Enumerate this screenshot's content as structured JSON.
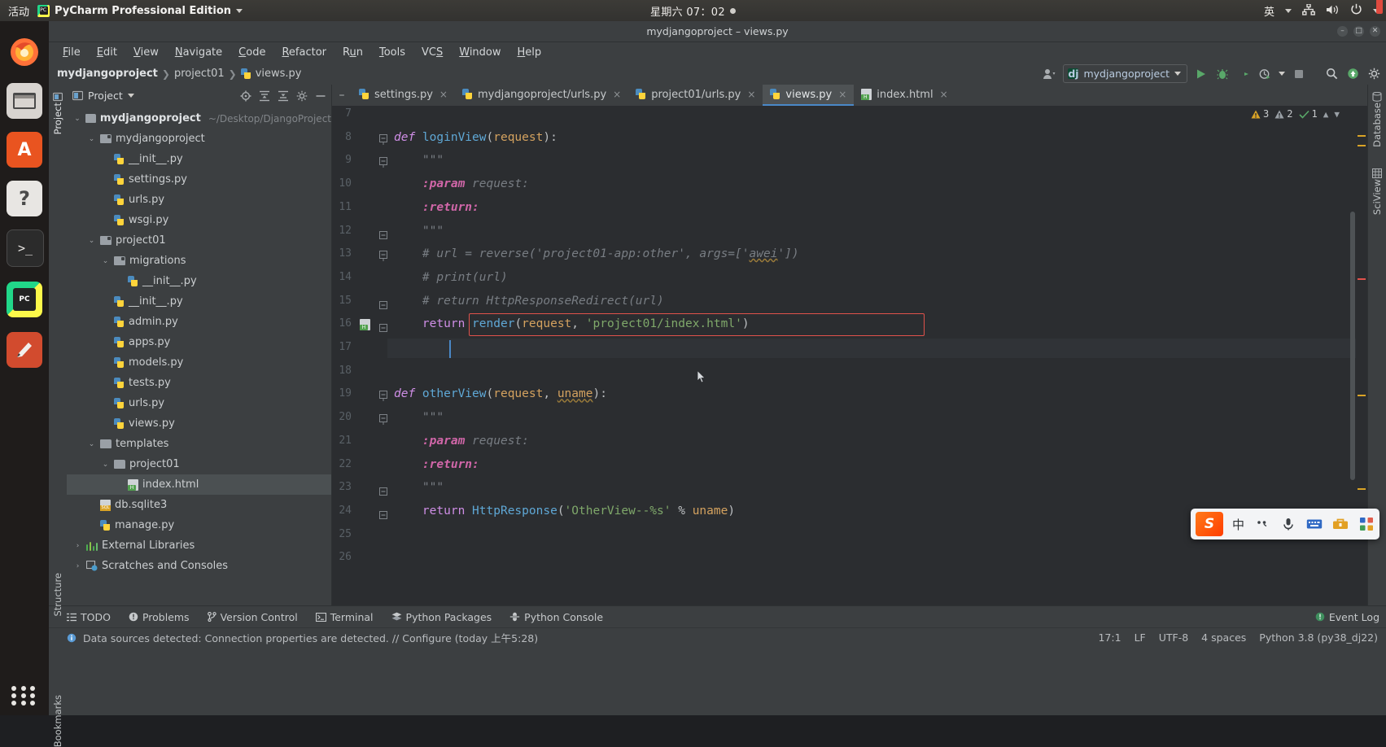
{
  "gnome": {
    "activities": "活动",
    "app_name": "PyCharm Professional Edition",
    "clock": "星期六 07：02",
    "input_method": "英",
    "tray": [
      "network-icon",
      "volume-icon",
      "power-icon"
    ]
  },
  "dock": {
    "items": [
      "firefox-icon",
      "files-icon",
      "software-icon",
      "help-icon",
      "terminal-icon",
      "pycharm-icon",
      "editor-icon",
      "app-grid-icon"
    ]
  },
  "window": {
    "title": "mydjangoproject – views.py",
    "buttons": [
      "minimize",
      "maximize",
      "close"
    ]
  },
  "menubar": {
    "items": [
      {
        "label": "File",
        "mnemonic": "F"
      },
      {
        "label": "Edit",
        "mnemonic": "E"
      },
      {
        "label": "View",
        "mnemonic": "V"
      },
      {
        "label": "Navigate",
        "mnemonic": "N"
      },
      {
        "label": "Code",
        "mnemonic": "C"
      },
      {
        "label": "Refactor",
        "mnemonic": "R"
      },
      {
        "label": "Run",
        "mnemonic": "u"
      },
      {
        "label": "Tools",
        "mnemonic": "T"
      },
      {
        "label": "VCS",
        "mnemonic": "S"
      },
      {
        "label": "Window",
        "mnemonic": "W"
      },
      {
        "label": "Help",
        "mnemonic": "H"
      }
    ]
  },
  "navbar": {
    "crumbs": [
      "mydjangoproject",
      "project01",
      "views.py"
    ],
    "run_config": "mydjangoproject",
    "actions": [
      "run-icon",
      "debug-icon",
      "coverage-icon",
      "profile-icon",
      "stop-icon",
      "search-everywhere-icon",
      "updates-icon",
      "settings-icon"
    ]
  },
  "project_panel": {
    "title": "Project",
    "toolbar_icons": [
      "locate-icon",
      "expand-all-icon",
      "collapse-all-icon",
      "settings-icon",
      "hide-icon"
    ],
    "tree": [
      {
        "indent": 0,
        "arrow": "v",
        "icon": "folder",
        "label": "mydjangoproject",
        "bold": true,
        "path": "~/Desktop/DjangoProject",
        "selected": false
      },
      {
        "indent": 1,
        "arrow": "v",
        "icon": "module",
        "label": "mydjangoproject",
        "bold": false,
        "path": "",
        "selected": false
      },
      {
        "indent": 2,
        "arrow": "",
        "icon": "python",
        "label": "__init__.py",
        "bold": false,
        "path": "",
        "selected": false
      },
      {
        "indent": 2,
        "arrow": "",
        "icon": "python",
        "label": "settings.py",
        "bold": false,
        "path": "",
        "selected": false
      },
      {
        "indent": 2,
        "arrow": "",
        "icon": "python",
        "label": "urls.py",
        "bold": false,
        "path": "",
        "selected": false
      },
      {
        "indent": 2,
        "arrow": "",
        "icon": "python",
        "label": "wsgi.py",
        "bold": false,
        "path": "",
        "selected": false
      },
      {
        "indent": 1,
        "arrow": "v",
        "icon": "module",
        "label": "project01",
        "bold": false,
        "path": "",
        "selected": false
      },
      {
        "indent": 2,
        "arrow": "v",
        "icon": "module",
        "label": "migrations",
        "bold": false,
        "path": "",
        "selected": false
      },
      {
        "indent": 3,
        "arrow": "",
        "icon": "python",
        "label": "__init__.py",
        "bold": false,
        "path": "",
        "selected": false
      },
      {
        "indent": 2,
        "arrow": "",
        "icon": "python",
        "label": "__init__.py",
        "bold": false,
        "path": "",
        "selected": false
      },
      {
        "indent": 2,
        "arrow": "",
        "icon": "python",
        "label": "admin.py",
        "bold": false,
        "path": "",
        "selected": false
      },
      {
        "indent": 2,
        "arrow": "",
        "icon": "python",
        "label": "apps.py",
        "bold": false,
        "path": "",
        "selected": false
      },
      {
        "indent": 2,
        "arrow": "",
        "icon": "python",
        "label": "models.py",
        "bold": false,
        "path": "",
        "selected": false
      },
      {
        "indent": 2,
        "arrow": "",
        "icon": "python",
        "label": "tests.py",
        "bold": false,
        "path": "",
        "selected": false
      },
      {
        "indent": 2,
        "arrow": "",
        "icon": "python",
        "label": "urls.py",
        "bold": false,
        "path": "",
        "selected": false
      },
      {
        "indent": 2,
        "arrow": "",
        "icon": "python",
        "label": "views.py",
        "bold": false,
        "path": "",
        "selected": false
      },
      {
        "indent": 1,
        "arrow": "v",
        "icon": "folder",
        "label": "templates",
        "bold": false,
        "path": "",
        "selected": false
      },
      {
        "indent": 2,
        "arrow": "v",
        "icon": "folder",
        "label": "project01",
        "bold": false,
        "path": "",
        "selected": false
      },
      {
        "indent": 3,
        "arrow": "",
        "icon": "html",
        "label": "index.html",
        "bold": false,
        "path": "",
        "selected": true
      },
      {
        "indent": 1,
        "arrow": "",
        "icon": "sql",
        "label": "db.sqlite3",
        "bold": false,
        "path": "",
        "selected": false
      },
      {
        "indent": 1,
        "arrow": "",
        "icon": "python",
        "label": "manage.py",
        "bold": false,
        "path": "",
        "selected": false
      },
      {
        "indent": 0,
        "arrow": ">",
        "icon": "lib",
        "label": "External Libraries",
        "bold": false,
        "path": "",
        "selected": false
      },
      {
        "indent": 0,
        "arrow": ">",
        "icon": "scratch",
        "label": "Scratches and Consoles",
        "bold": false,
        "path": "",
        "selected": false
      }
    ]
  },
  "left_strip": {
    "project": "Project",
    "structure": "Structure",
    "bookmarks": "Bookmarks"
  },
  "right_strip": {
    "database": "Database",
    "sciview": "SciView"
  },
  "tabs": [
    {
      "label": "settings.py",
      "icon": "python",
      "active": false
    },
    {
      "label": "mydjangoproject/urls.py",
      "icon": "python",
      "active": false
    },
    {
      "label": "project01/urls.py",
      "icon": "python",
      "active": false
    },
    {
      "label": "views.py",
      "icon": "python",
      "active": true
    },
    {
      "label": "index.html",
      "icon": "html",
      "active": false
    }
  ],
  "inspection": {
    "warnings": "3",
    "weak_warnings": "2",
    "typos": "1"
  },
  "editor": {
    "first_line": 7,
    "lines": [
      {
        "n": 7,
        "tokens": [],
        "fold": ""
      },
      {
        "n": 8,
        "tokens": [
          {
            "t": "def ",
            "c": "kw"
          },
          {
            "t": "loginView",
            "c": "fn"
          },
          {
            "t": "(",
            "c": "plain"
          },
          {
            "t": "request",
            "c": "param"
          },
          {
            "t": "):",
            "c": "plain"
          }
        ],
        "fold": "minus-top"
      },
      {
        "n": 9,
        "tokens": [
          {
            "t": "    \"\"\"",
            "c": "doc"
          }
        ],
        "fold": "minus-top"
      },
      {
        "n": 10,
        "tokens": [
          {
            "t": "    ",
            "c": "doc"
          },
          {
            "t": ":param",
            "c": "dockw"
          },
          {
            "t": " request:",
            "c": "doc"
          }
        ],
        "fold": ""
      },
      {
        "n": 11,
        "tokens": [
          {
            "t": "    ",
            "c": "doc"
          },
          {
            "t": ":return:",
            "c": "dockw"
          }
        ],
        "fold": ""
      },
      {
        "n": 12,
        "tokens": [
          {
            "t": "    \"\"\"",
            "c": "doc"
          }
        ],
        "fold": "minus-bot"
      },
      {
        "n": 13,
        "tokens": [
          {
            "t": "    # url = reverse('project01-app:other', args=['",
            "c": "cmt"
          },
          {
            "t": "awei",
            "c": "cmt wavy"
          },
          {
            "t": "'])",
            "c": "cmt"
          }
        ],
        "fold": "minus-top"
      },
      {
        "n": 14,
        "tokens": [
          {
            "t": "    # print(url)",
            "c": "cmt"
          }
        ],
        "fold": ""
      },
      {
        "n": 15,
        "tokens": [
          {
            "t": "    # return HttpResponseRedirect(url)",
            "c": "cmt"
          }
        ],
        "fold": "minus-bot"
      },
      {
        "n": 16,
        "tokens": [
          {
            "t": "    ",
            "c": "plain"
          },
          {
            "t": "return",
            "c": "kw2"
          },
          {
            "t": " ",
            "c": "plain"
          },
          {
            "t": "render",
            "c": "fn"
          },
          {
            "t": "(",
            "c": "plain"
          },
          {
            "t": "request",
            "c": "param"
          },
          {
            "t": ", ",
            "c": "plain"
          },
          {
            "t": "'project01/index.html'",
            "c": "str"
          },
          {
            "t": ")",
            "c": "plain"
          }
        ],
        "fold": "minus-bot",
        "gutter_icon": "html",
        "highlight_box": true
      },
      {
        "n": 17,
        "tokens": [],
        "fold": "",
        "caret": true
      },
      {
        "n": 18,
        "tokens": [],
        "fold": ""
      },
      {
        "n": 19,
        "tokens": [
          {
            "t": "def ",
            "c": "kw"
          },
          {
            "t": "otherView",
            "c": "fn"
          },
          {
            "t": "(",
            "c": "plain"
          },
          {
            "t": "request",
            "c": "param"
          },
          {
            "t": ", ",
            "c": "plain"
          },
          {
            "t": "uname",
            "c": "param wavy"
          },
          {
            "t": "):",
            "c": "plain"
          }
        ],
        "fold": "minus-top"
      },
      {
        "n": 20,
        "tokens": [
          {
            "t": "    \"\"\"",
            "c": "doc"
          }
        ],
        "fold": "minus-top"
      },
      {
        "n": 21,
        "tokens": [
          {
            "t": "    ",
            "c": "doc"
          },
          {
            "t": ":param",
            "c": "dockw"
          },
          {
            "t": " request:",
            "c": "doc"
          }
        ],
        "fold": ""
      },
      {
        "n": 22,
        "tokens": [
          {
            "t": "    ",
            "c": "doc"
          },
          {
            "t": ":return:",
            "c": "dockw"
          }
        ],
        "fold": ""
      },
      {
        "n": 23,
        "tokens": [
          {
            "t": "    \"\"\"",
            "c": "doc"
          }
        ],
        "fold": "minus-bot"
      },
      {
        "n": 24,
        "tokens": [
          {
            "t": "    ",
            "c": "plain"
          },
          {
            "t": "return",
            "c": "kw2"
          },
          {
            "t": " ",
            "c": "plain"
          },
          {
            "t": "HttpResponse",
            "c": "fn"
          },
          {
            "t": "(",
            "c": "plain"
          },
          {
            "t": "'OtherView--%s'",
            "c": "str"
          },
          {
            "t": " % ",
            "c": "plain"
          },
          {
            "t": "uname",
            "c": "param"
          },
          {
            "t": ")",
            "c": "plain"
          }
        ],
        "fold": "minus-bot"
      },
      {
        "n": 25,
        "tokens": [],
        "fold": ""
      },
      {
        "n": 26,
        "tokens": [],
        "fold": ""
      }
    ]
  },
  "bottom_toolbar": [
    {
      "label": "TODO",
      "icon": "todo-icon"
    },
    {
      "label": "Problems",
      "icon": "problems-icon"
    },
    {
      "label": "Version Control",
      "icon": "vcs-icon"
    },
    {
      "label": "Terminal",
      "icon": "terminal-icon"
    },
    {
      "label": "Python Packages",
      "icon": "packages-icon"
    },
    {
      "label": "Python Console",
      "icon": "console-icon"
    }
  ],
  "event_log": "Event Log",
  "statusbar": {
    "message": "Data sources detected: Connection properties are detected. // Configure (today 上午5:28)",
    "position": "17:1",
    "line_ending": "LF",
    "encoding": "UTF-8",
    "indent": "4 spaces",
    "interpreter": "Python 3.8 (py38_dj22)"
  },
  "ime": {
    "mode": "中",
    "items": [
      "sogou-logo",
      "mode-chinese",
      "punctuation-icon",
      "microphone-icon",
      "keyboard-icon",
      "toolbox-icon",
      "apps-icon"
    ]
  },
  "colors": {
    "accent_blue": "#4a88c7",
    "error_red": "#e0524b",
    "string_green": "#7fa86a",
    "keyword_purple": "#cf8ee6",
    "function_blue": "#5fa8d6",
    "comment_gray": "#787d83"
  }
}
